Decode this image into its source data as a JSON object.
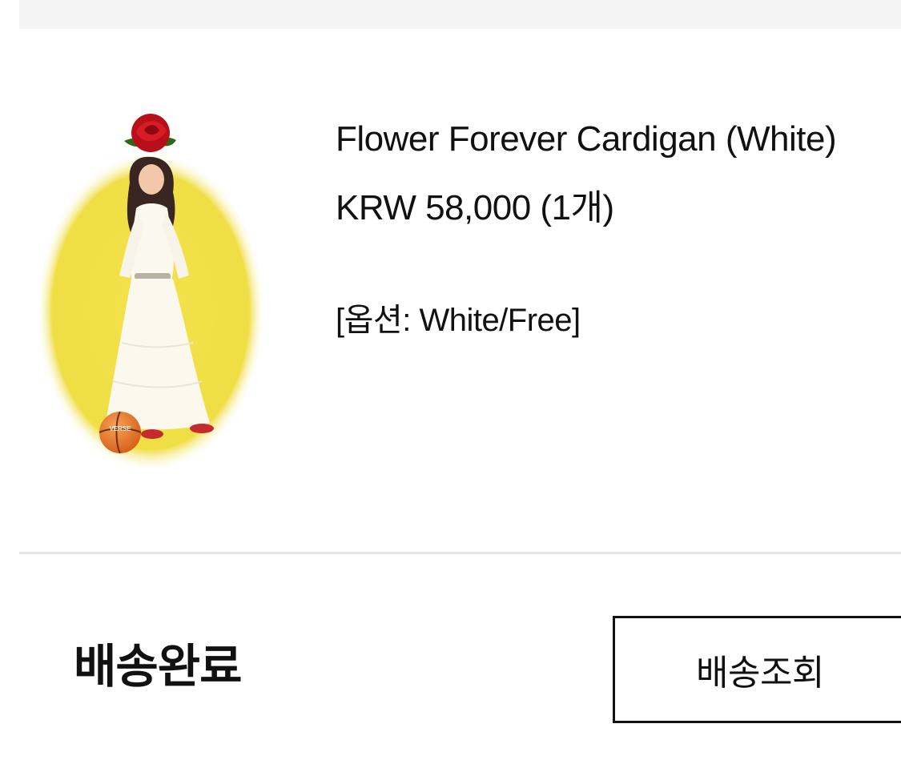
{
  "product": {
    "name": "Flower Forever Cardigan (White)",
    "price": "KRW 58,000 (1개)",
    "option": "[옵션: White/Free]",
    "image_alt": "Model in white cardigan and long white skirt on yellow oval background with a red rose and basketball",
    "ball_logo_text": "VERSE"
  },
  "delivery": {
    "status": "배송완료",
    "track_button_label": "배송조회"
  },
  "colors": {
    "background": "#ffffff",
    "top_band": "#f4f4f4",
    "divider": "#e6e6e6",
    "text": "#111111",
    "image_oval": "#f1e04a",
    "rose": "#c8141c",
    "ball": "#e8782a"
  }
}
